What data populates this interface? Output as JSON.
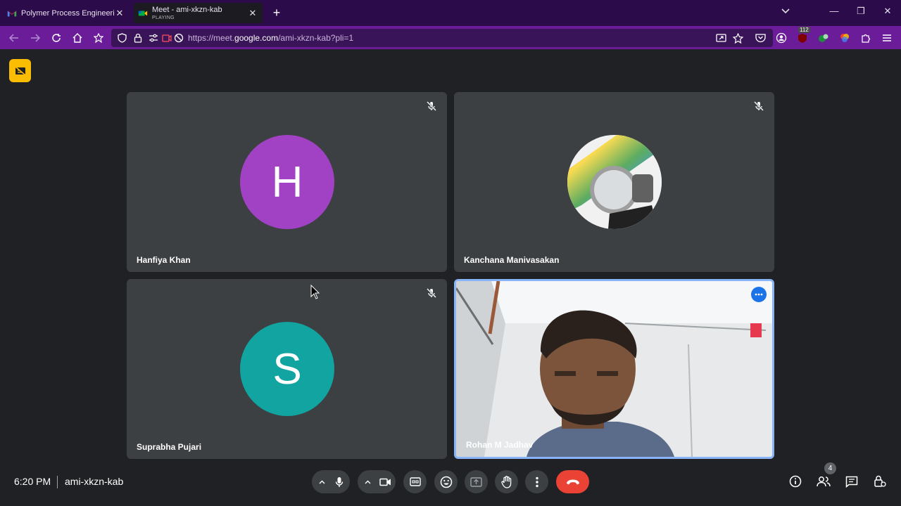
{
  "browser": {
    "tabs": [
      {
        "title": "Polymer Process Engineering : P",
        "favicon": "gmail-icon"
      },
      {
        "title": "Meet - ami-xkzn-kab",
        "subtitle": "PLAYING",
        "favicon": "meet-icon"
      }
    ],
    "url_prefix": "https://meet.",
    "url_domain": "google.com",
    "url_path": "/ami-xkzn-kab?pli=1",
    "extension_badge": "112"
  },
  "meet": {
    "participants": [
      {
        "name": "Hanfiya Khan",
        "initial": "H",
        "avatar_color": "#a142c4",
        "muted": true
      },
      {
        "name": "Kanchana Manivasakan",
        "initial": "",
        "avatar_color": "#ffffff",
        "muted": true
      },
      {
        "name": "Suprabha Pujari",
        "initial": "S",
        "avatar_color": "#12a4a0",
        "muted": true
      },
      {
        "name": "Rohan M Jadhav",
        "initial": "",
        "video": true,
        "muted": false
      }
    ],
    "time": "6:20 PM",
    "meeting_code": "ami-xkzn-kab",
    "people_count": "4"
  },
  "colors": {
    "accent": "#8ab4f8",
    "end_call": "#ea4335",
    "badge": "#fbbc04"
  }
}
